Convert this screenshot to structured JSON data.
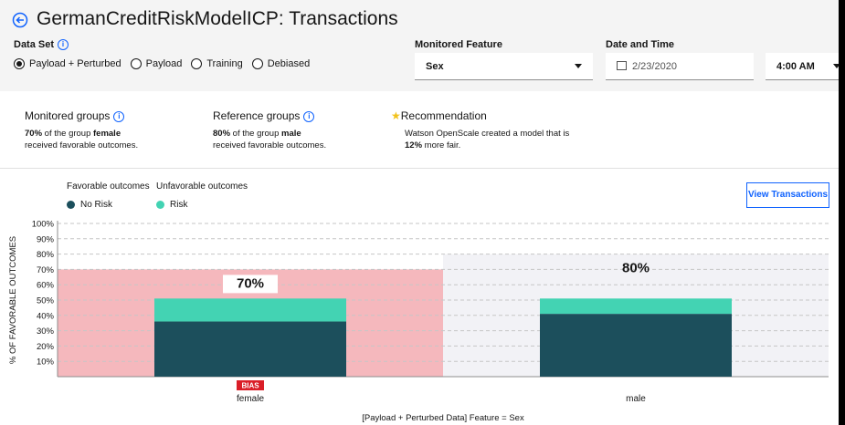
{
  "title": "GermanCreditRiskModelICP: Transactions",
  "data_set": {
    "label": "Data Set",
    "options": [
      "Payload + Perturbed",
      "Payload",
      "Training",
      "Debiased"
    ],
    "selected": "Payload + Perturbed"
  },
  "monitored_feature": {
    "label": "Monitored Feature",
    "value": "Sex"
  },
  "date_time": {
    "label": "Date and Time",
    "date": "2/23/2020",
    "time": "4:00 AM"
  },
  "summary": {
    "monitored": {
      "heading": "Monitored groups",
      "pct": "70%",
      "pre": " of the group ",
      "group": "female",
      "post": "received favorable outcomes."
    },
    "reference": {
      "heading": "Reference groups",
      "pct": "80%",
      "pre": " of the group ",
      "group": "male",
      "post": "received favorable outcomes."
    },
    "recommendation": {
      "heading": "Recommendation",
      "line1": "Watson OpenScale created a model that is",
      "pct": "12%",
      "post": " more fair."
    }
  },
  "legend": {
    "favorable_title": "Favorable outcomes",
    "unfavorable_title": "Unfavorable outcomes",
    "favorable_item": "No Risk",
    "unfavorable_item": "Risk"
  },
  "view_transactions_label": "View Transactions",
  "colors": {
    "no_risk": "#1c4f5c",
    "risk": "#43d3b3",
    "bias_band": "#f5b8bd",
    "ref_band": "#f2f2f6",
    "bias_tag": "#da1e28",
    "accent": "#0f62fe"
  },
  "chart_data": {
    "type": "bar",
    "ylabel": "% OF FAVORABLE OUTCOMES",
    "xlabel": "[Payload + Perturbed Data] Feature = Sex",
    "yticks": [
      "100%",
      "90%",
      "80%",
      "70%",
      "60%",
      "50%",
      "40%",
      "30%",
      "20%",
      "10%"
    ],
    "ylim": [
      0,
      100
    ],
    "categories": [
      "female",
      "male"
    ],
    "series": [
      {
        "name": "No Risk",
        "values": [
          36,
          41
        ]
      },
      {
        "name": "Risk",
        "values": [
          15,
          10
        ]
      }
    ],
    "group_labels": [
      "70%",
      "80%"
    ],
    "group_values": [
      70,
      80
    ],
    "bias_tag": "BIAS",
    "bias_category": "female"
  }
}
